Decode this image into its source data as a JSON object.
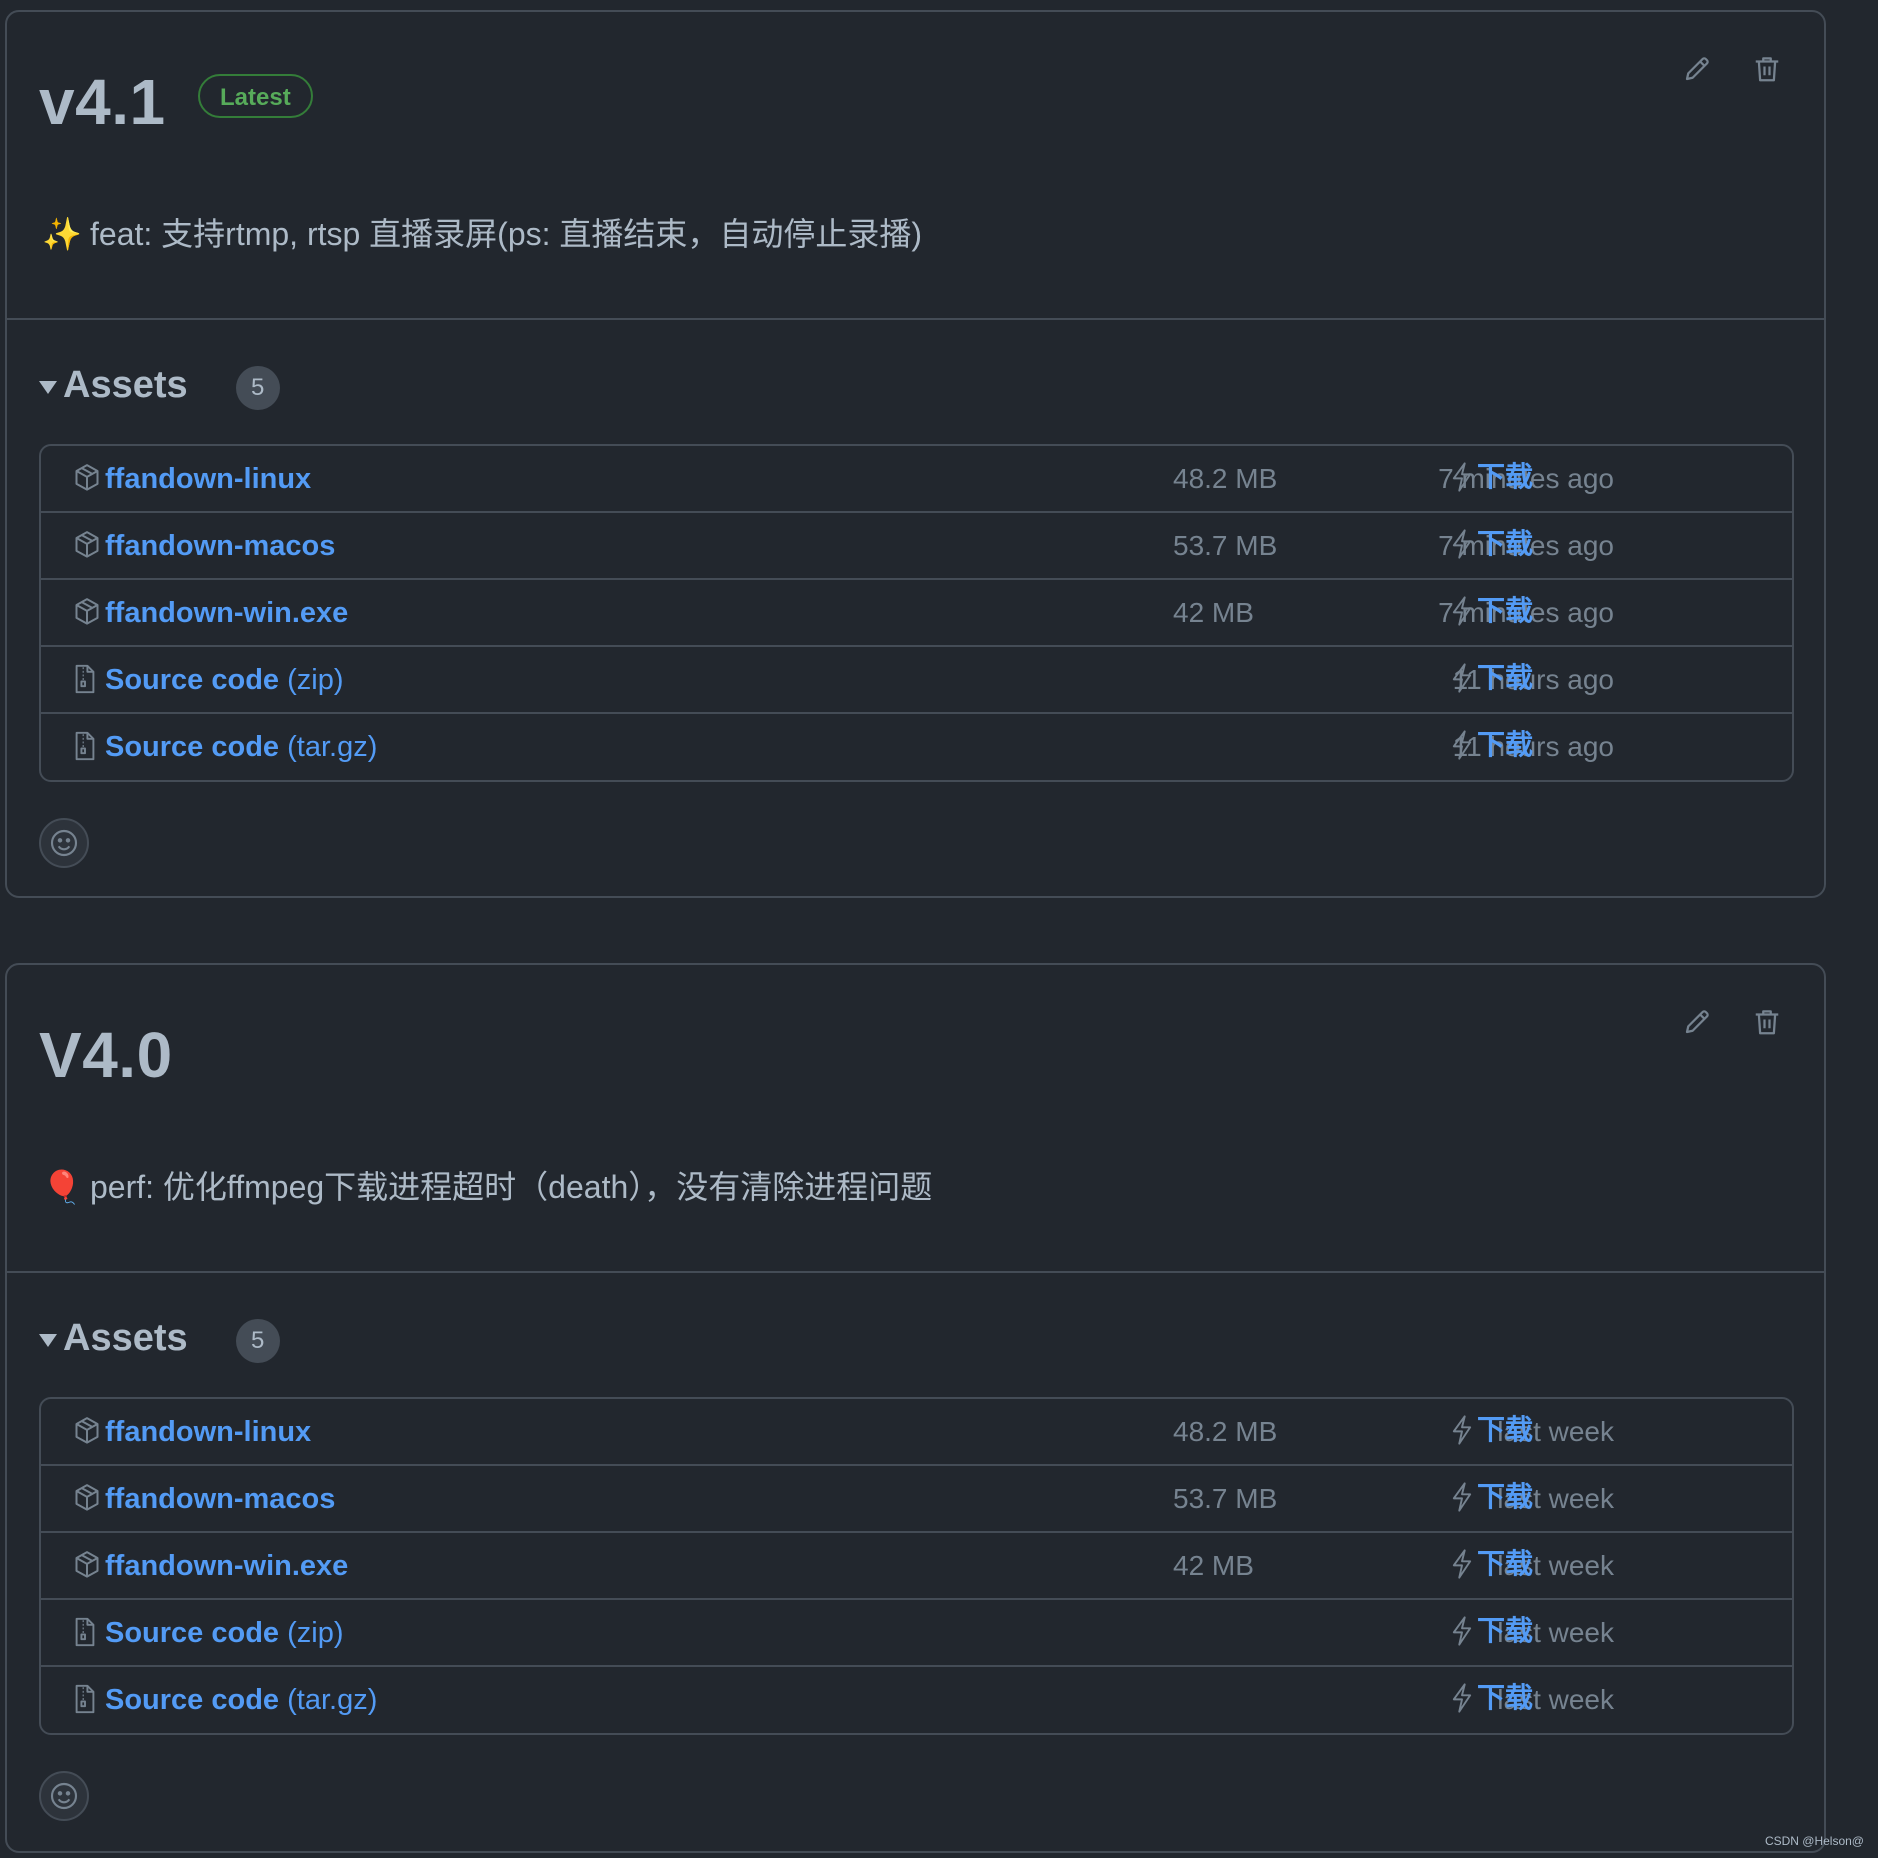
{
  "releases": [
    {
      "title": "v4.1",
      "badge": "Latest",
      "notes_emoji": "✨",
      "notes": "feat: 支持rtmp, rtsp 直播录屏(ps: 直播结束，自动停止录播)",
      "assets_label": "Assets",
      "assets_count": "5",
      "assets": [
        {
          "icon": "package-icon",
          "name": "ffandown-linux",
          "suffix": "",
          "size": "48.2 MB",
          "time": "7 minutes ago",
          "download": "下载"
        },
        {
          "icon": "package-icon",
          "name": "ffandown-macos",
          "suffix": "",
          "size": "53.7 MB",
          "time": "7 minutes ago",
          "download": "下载"
        },
        {
          "icon": "package-icon",
          "name": "ffandown-win.exe",
          "suffix": "",
          "size": "42 MB",
          "time": "7 minutes ago",
          "download": "下载"
        },
        {
          "icon": "file-zip-icon",
          "name": "Source code",
          "suffix": " (zip)",
          "size": "",
          "time": "11 hours ago",
          "download": "下载"
        },
        {
          "icon": "file-zip-icon",
          "name": "Source code",
          "suffix": " (tar.gz)",
          "size": "",
          "time": "11 hours ago",
          "download": "下载"
        }
      ]
    },
    {
      "title": "V4.0",
      "badge": "",
      "notes_emoji": "🎈",
      "notes": "perf: 优化ffmpeg下载进程超时（death），没有清除进程问题",
      "assets_label": "Assets",
      "assets_count": "5",
      "assets": [
        {
          "icon": "package-icon",
          "name": "ffandown-linux",
          "suffix": "",
          "size": "48.2 MB",
          "time": "last week",
          "download": "下载"
        },
        {
          "icon": "package-icon",
          "name": "ffandown-macos",
          "suffix": "",
          "size": "53.7 MB",
          "time": "last week",
          "download": "下载"
        },
        {
          "icon": "package-icon",
          "name": "ffandown-win.exe",
          "suffix": "",
          "size": "42 MB",
          "time": "last week",
          "download": "下载"
        },
        {
          "icon": "file-zip-icon",
          "name": "Source code",
          "suffix": " (zip)",
          "size": "",
          "time": "last week",
          "download": "下载"
        },
        {
          "icon": "file-zip-icon",
          "name": "Source code",
          "suffix": " (tar.gz)",
          "size": "",
          "time": "last week",
          "download": "下载"
        }
      ]
    }
  ],
  "watermark": "CSDN @Helson@",
  "colors": {
    "background": "#22272e",
    "border": "#444c56",
    "link": "#539bf5",
    "muted": "#768390",
    "text": "#adbac7",
    "latest_green": "#57ab5a"
  }
}
